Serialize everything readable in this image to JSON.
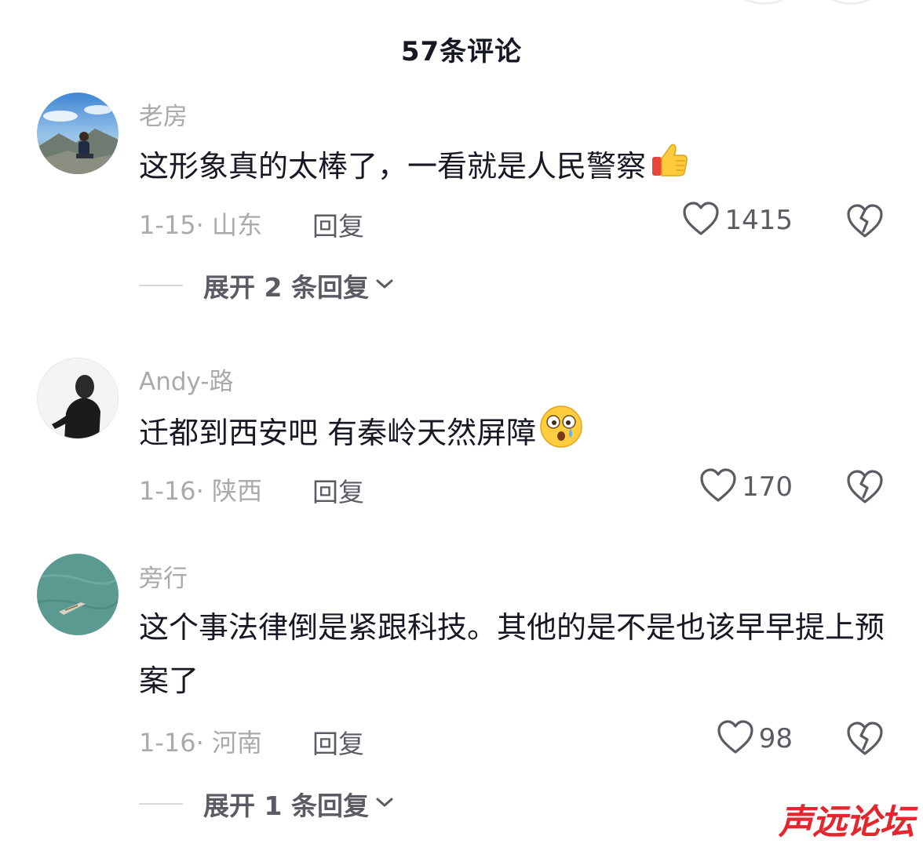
{
  "header": {
    "title": "57条评论"
  },
  "comments": [
    {
      "username": "老房",
      "text": "这形象真的太棒了，一看就是人民警察",
      "emoji": "thumbs-up-emoji",
      "date": "1-15",
      "location": "· 山东",
      "reply_label": "回复",
      "likes": "1415",
      "expand_label": "展开 2 条回复"
    },
    {
      "username": "Andy-路",
      "text": "迁都到西安吧 有秦岭天然屏障",
      "emoji": "shocked-face-emoji",
      "date": "1-16",
      "location": "· 陕西",
      "reply_label": "回复",
      "likes": "170"
    },
    {
      "username": "旁行",
      "text": "这个事法律倒是紧跟科技。其他的是不是也该早早提上预案了",
      "date": "1-16",
      "location": "· 河南",
      "reply_label": "回复",
      "likes": "98",
      "expand_label": "展开 1 条回复"
    }
  ],
  "watermark": "声远论坛",
  "colors": {
    "primary_text": "#161823",
    "secondary_text": "#a9aaae",
    "action_text": "#5b5c63",
    "watermark": "#e5262e"
  }
}
